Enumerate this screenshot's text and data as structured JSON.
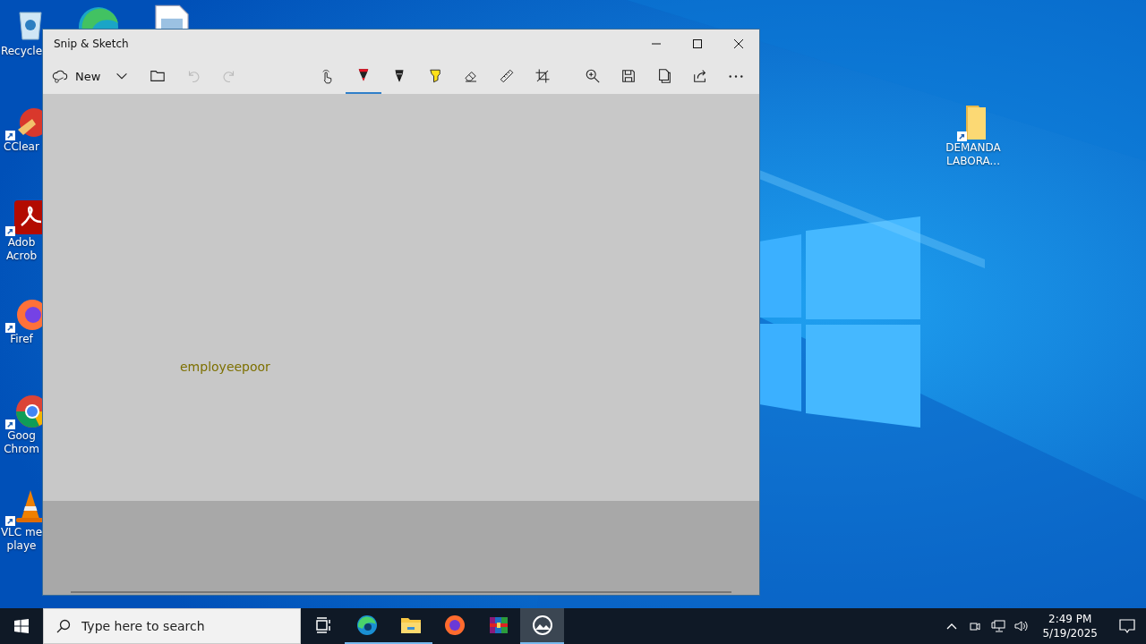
{
  "desktop": {
    "icons": [
      {
        "kind": "recycle",
        "shortcut": false,
        "lines": [
          "Recycle"
        ]
      },
      {
        "kind": "ccleaner",
        "shortcut": true,
        "lines": [
          "CClear"
        ]
      },
      {
        "kind": "pdf",
        "shortcut": true,
        "lines": [
          "Adob",
          "Acrob"
        ]
      },
      {
        "kind": "firefox",
        "shortcut": true,
        "lines": [
          "Firef"
        ]
      },
      {
        "kind": "chrome",
        "shortcut": true,
        "lines": [
          "Goog",
          "Chrom"
        ]
      },
      {
        "kind": "vlc",
        "shortcut": true,
        "lines": [
          "VLC me",
          "playe"
        ]
      }
    ],
    "top_icons": [
      {
        "kind": "edge"
      },
      {
        "kind": "document"
      }
    ],
    "folder": {
      "shortcut": true,
      "lines": [
        "DEMANDA",
        "LABORA..."
      ]
    }
  },
  "window": {
    "title": "Snip & Sketch",
    "toolbar": {
      "new_label": "New",
      "undo_disabled": true,
      "redo_disabled": true,
      "tools": [
        {
          "kind": "touch",
          "selected": false
        },
        {
          "kind": "pen",
          "selected": true
        },
        {
          "kind": "pencil",
          "selected": false
        },
        {
          "kind": "highlighter",
          "selected": false
        },
        {
          "kind": "eraser",
          "selected": false
        },
        {
          "kind": "ruler",
          "selected": false
        },
        {
          "kind": "crop",
          "selected": false
        }
      ]
    },
    "canvas_text": "employeepoor"
  },
  "taskbar": {
    "search": {
      "placeholder": "Type here to search"
    },
    "apps": [
      {
        "kind": "task-view",
        "running": false,
        "active": false
      },
      {
        "kind": "edge",
        "running": true,
        "active": false
      },
      {
        "kind": "explorer",
        "running": true,
        "active": false
      },
      {
        "kind": "firefox",
        "running": false,
        "active": false
      },
      {
        "kind": "winrar",
        "running": false,
        "active": false
      },
      {
        "kind": "snip",
        "running": true,
        "active": true
      }
    ],
    "time": "2:49 PM",
    "date": "5/19/2025"
  }
}
